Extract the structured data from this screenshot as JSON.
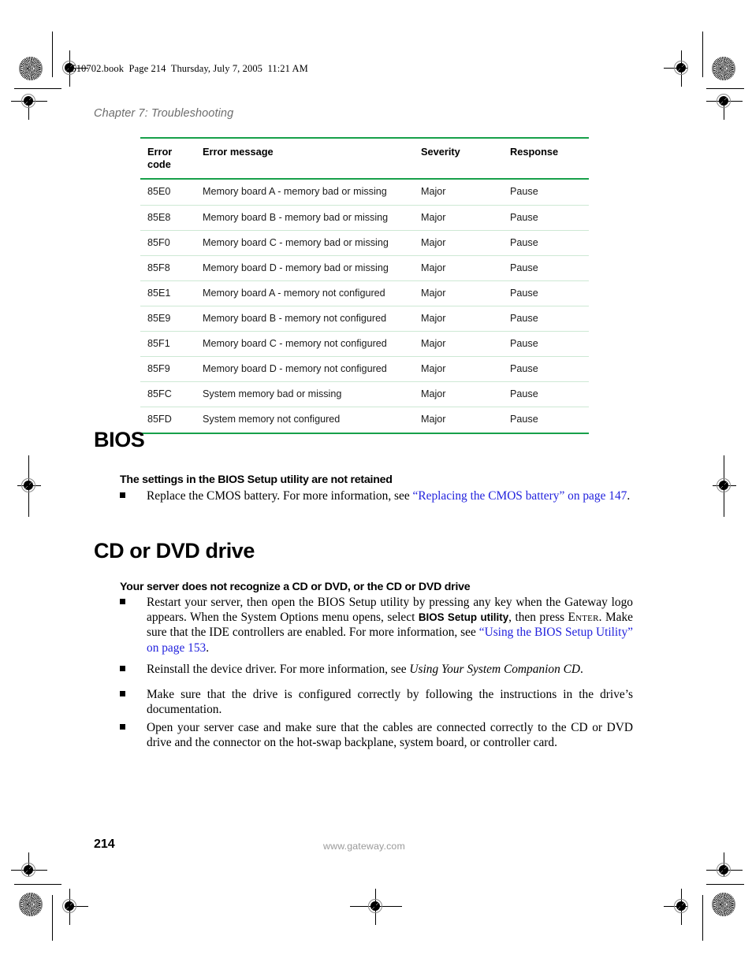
{
  "header": {
    "book_line": "8510702.book  Page 214  Thursday, July 7, 2005  11:21 AM",
    "chapter": "Chapter 7: Troubleshooting"
  },
  "error_table": {
    "columns": [
      "Error code",
      "Error message",
      "Severity",
      "Response"
    ],
    "column_code_line1": "Error",
    "column_code_line2": "code",
    "rows": [
      {
        "code": "85E0",
        "message": "Memory board A - memory bad or missing",
        "severity": "Major",
        "response": "Pause"
      },
      {
        "code": "85E8",
        "message": "Memory board B - memory bad or missing",
        "severity": "Major",
        "response": "Pause"
      },
      {
        "code": "85F0",
        "message": "Memory board C - memory bad or missing",
        "severity": "Major",
        "response": "Pause"
      },
      {
        "code": "85F8",
        "message": "Memory board D - memory bad or missing",
        "severity": "Major",
        "response": "Pause"
      },
      {
        "code": "85E1",
        "message": "Memory board A - memory not configured",
        "severity": "Major",
        "response": "Pause"
      },
      {
        "code": "85E9",
        "message": "Memory board B - memory not configured",
        "severity": "Major",
        "response": "Pause"
      },
      {
        "code": "85F1",
        "message": "Memory board C - memory not configured",
        "severity": "Major",
        "response": "Pause"
      },
      {
        "code": "85F9",
        "message": "Memory board D - memory not configured",
        "severity": "Major",
        "response": "Pause"
      },
      {
        "code": "85FC",
        "message": "System memory bad or missing",
        "severity": "Major",
        "response": "Pause"
      },
      {
        "code": "85FD",
        "message": "System memory not configured",
        "severity": "Major",
        "response": "Pause"
      }
    ],
    "rule_color": "#17A04A",
    "row_rule_color": "#cde8d4"
  },
  "bios_section": {
    "title": "BIOS",
    "subheading": "The settings in the BIOS Setup utility are not retained",
    "bullet": {
      "lead": "Replace the CMOS battery. For more information, see ",
      "link": "“Replacing the CMOS battery” on page 147",
      "tail": "."
    }
  },
  "cd_dvd_section": {
    "title": "CD or DVD drive",
    "subheading": "Your server does not recognize a CD or DVD, or the CD or DVD drive",
    "bullets": [
      {
        "part1": "Restart your server, then open the BIOS Setup utility by pressing any key when the Gateway logo appears. When the System Options menu opens, select ",
        "bold1": "BIOS Setup utility",
        "part2": ", then press ",
        "smallcaps": "Enter",
        "part3": ". Make sure that the IDE controllers are enabled. For more information, see ",
        "link": "“Using the BIOS Setup Utility” on page 153",
        "part4": "."
      },
      {
        "part1": "Reinstall the device driver. For more information, see ",
        "italic": "Using Your System Companion CD",
        "part2": "."
      },
      {
        "part1": "Make sure that the drive is configured correctly by following the instructions in the drive’s documentation."
      },
      {
        "part1": "Open your server case and make sure that the cables are connected correctly to the CD or DVD drive and the connector on the hot-swap backplane, system board, or controller card."
      }
    ]
  },
  "footer": {
    "page_number": "214",
    "website": "www.gateway.com"
  },
  "link_color": "#2222DD"
}
